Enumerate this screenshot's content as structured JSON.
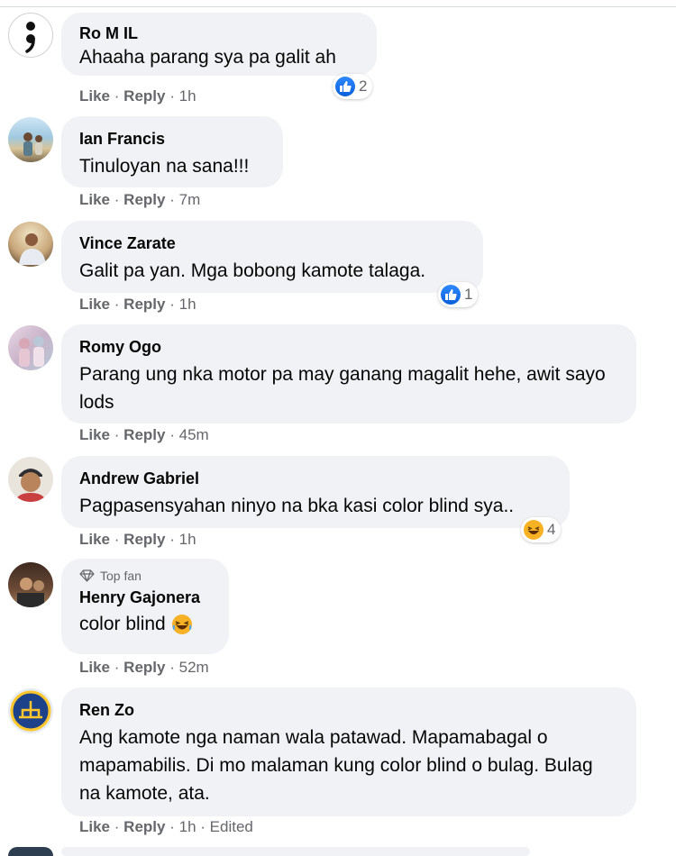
{
  "comments": [
    {
      "name": "Ro M IL",
      "text": "Ahaaha parang sya pa galit ah",
      "time": "1h",
      "reaction": {
        "type": "like",
        "count": "2"
      }
    },
    {
      "name": "Ian Francis",
      "text": "Tinuloyan na sana!!!",
      "time": "7m"
    },
    {
      "name": "Vince Zarate",
      "text": "Galit pa yan. Mga bobong kamote talaga.",
      "time": "1h",
      "reaction": {
        "type": "like",
        "count": "1"
      }
    },
    {
      "name": "Romy Ogo",
      "text": "Parang ung nka motor pa may ganang magalit hehe, awit sayo lods",
      "time": "45m"
    },
    {
      "name": "Andrew Gabriel",
      "text": "Pagpasensyahan ninyo na bka kasi color blind sya..",
      "time": "1h",
      "reaction": {
        "type": "haha",
        "count": "4"
      }
    },
    {
      "badge": "Top fan",
      "name": "Henry Gajonera",
      "text": "color blind",
      "time": "52m"
    },
    {
      "name": "Ren Zo",
      "text": "Ang kamote nga naman wala patawad. Mapamabagal o mapamabilis. Di mo malaman kung color blind o bulag. Bulag na kamote, ata.",
      "time": "1h",
      "edited": "Edited"
    }
  ],
  "actions": {
    "like": "Like",
    "reply": "Reply",
    "separator": "·"
  },
  "colors": {
    "bubble": "#f0f2f5",
    "meta": "#65676b",
    "like_blue": "#1877f2",
    "haha_yellow": "#f7b125"
  }
}
